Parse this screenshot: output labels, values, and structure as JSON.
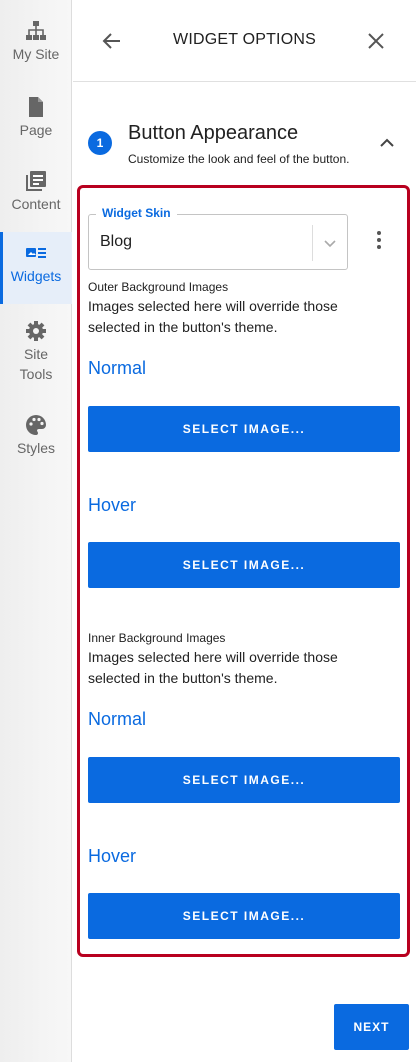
{
  "nav": {
    "items": [
      {
        "label": "My Site",
        "icon": "sitemap-icon"
      },
      {
        "label": "Page",
        "icon": "page-icon"
      },
      {
        "label": "Content",
        "icon": "content-icon"
      },
      {
        "label": "Widgets",
        "icon": "widgets-icon",
        "active": true
      },
      {
        "label": "Site Tools",
        "icon": "gear-icon"
      },
      {
        "label": "Styles",
        "icon": "palette-icon"
      }
    ]
  },
  "header": {
    "title": "WIDGET OPTIONS"
  },
  "step": {
    "number": "1",
    "title": "Button Appearance",
    "subtitle": "Customize the look and feel of the button."
  },
  "skin": {
    "label": "Widget Skin",
    "value": "Blog"
  },
  "outer": {
    "label": "Outer Background Images",
    "description": "Images selected here will override those selected in the button's theme.",
    "normal_label": "Normal",
    "hover_label": "Hover",
    "button_label": "SELECT IMAGE..."
  },
  "inner": {
    "label": "Inner Background Images",
    "description": "Images selected here will override those selected in the button's theme.",
    "normal_label": "Normal",
    "hover_label": "Hover",
    "button_label": "SELECT IMAGE..."
  },
  "footer": {
    "next_label": "NEXT"
  },
  "colors": {
    "accent": "#0a6ae0",
    "highlight_border": "#b8001f"
  }
}
